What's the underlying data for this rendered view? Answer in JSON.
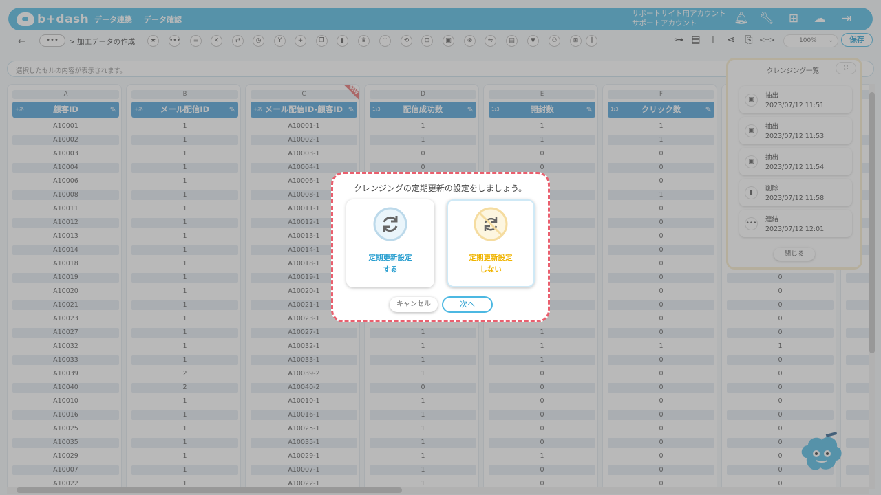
{
  "header": {
    "logo_text": "b+dash",
    "nav": [
      "データ連携",
      "データ確認"
    ],
    "account_lines": [
      "サポートサイト用アカウント",
      "サポートアカウント"
    ],
    "colors": {
      "brand": "#4cb8e2",
      "column_head": "#4a9fd8",
      "alert": "#ea5f6e"
    }
  },
  "toolbar": {
    "back_icon": "←",
    "more_icon": "•••",
    "breadcrumb": "> 加工データの作成",
    "zoom": "100%",
    "save_label": "保存"
  },
  "cell_bar": {
    "placeholder": "選択したセルの内容が表示されます。"
  },
  "grid": {
    "columns": [
      {
        "letter": "A",
        "name": "顧客ID",
        "type_icon": "+あ"
      },
      {
        "letter": "B",
        "name": "メール配信ID",
        "type_icon": "+あ"
      },
      {
        "letter": "C",
        "name": "メール配信ID-顧客ID",
        "type_icon": "+あ",
        "badge": "NEW"
      },
      {
        "letter": "D",
        "name": "配信成功数",
        "type_icon": "1₂3"
      },
      {
        "letter": "E",
        "name": "開封数",
        "type_icon": "1₂3"
      },
      {
        "letter": "F",
        "name": "クリック数",
        "type_icon": "1₂3"
      },
      {
        "letter": "",
        "name": "",
        "type_icon": ""
      },
      {
        "letter": "",
        "name": "",
        "type_icon": ""
      }
    ],
    "rows": [
      [
        "A10001",
        "1",
        "A10001-1",
        "1",
        "1",
        "1",
        "",
        ""
      ],
      [
        "A10002",
        "1",
        "A10002-1",
        "1",
        "1",
        "1",
        "",
        ""
      ],
      [
        "A10003",
        "1",
        "A10003-1",
        "0",
        "0",
        "0",
        "",
        ""
      ],
      [
        "A10004",
        "1",
        "A10004-1",
        "0",
        "0",
        "0",
        "",
        ""
      ],
      [
        "A10006",
        "1",
        "A10006-1",
        "",
        "",
        "0",
        "",
        ""
      ],
      [
        "A10008",
        "1",
        "A10008-1",
        "",
        "",
        "1",
        "",
        ""
      ],
      [
        "A10011",
        "1",
        "A10011-1",
        "",
        "",
        "0",
        "",
        ""
      ],
      [
        "A10012",
        "1",
        "A10012-1",
        "",
        "",
        "0",
        "",
        ""
      ],
      [
        "A10013",
        "1",
        "A10013-1",
        "",
        "",
        "0",
        "",
        ""
      ],
      [
        "A10014",
        "1",
        "A10014-1",
        "",
        "",
        "0",
        "",
        ""
      ],
      [
        "A10018",
        "1",
        "A10018-1",
        "",
        "",
        "0",
        "",
        ""
      ],
      [
        "A10019",
        "1",
        "A10019-1",
        "",
        "",
        "0",
        "0",
        ""
      ],
      [
        "A10020",
        "1",
        "A10020-1",
        "",
        "",
        "0",
        "0",
        ""
      ],
      [
        "A10021",
        "1",
        "A10021-1",
        "",
        "",
        "0",
        "0",
        ""
      ],
      [
        "A10023",
        "1",
        "A10023-1",
        "",
        "",
        "0",
        "0",
        ""
      ],
      [
        "A10027",
        "1",
        "A10027-1",
        "1",
        "1",
        "0",
        "0",
        ""
      ],
      [
        "A10032",
        "1",
        "A10032-1",
        "1",
        "1",
        "1",
        "1",
        ""
      ],
      [
        "A10033",
        "1",
        "A10033-1",
        "1",
        "1",
        "0",
        "0",
        ""
      ],
      [
        "A10039",
        "2",
        "A10039-2",
        "1",
        "0",
        "0",
        "0",
        ""
      ],
      [
        "A10040",
        "2",
        "A10040-2",
        "0",
        "0",
        "0",
        "0",
        ""
      ],
      [
        "A10010",
        "1",
        "A10010-1",
        "1",
        "0",
        "0",
        "0",
        ""
      ],
      [
        "A10016",
        "1",
        "A10016-1",
        "1",
        "0",
        "0",
        "0",
        ""
      ],
      [
        "A10025",
        "1",
        "A10025-1",
        "1",
        "0",
        "0",
        "0",
        ""
      ],
      [
        "A10035",
        "1",
        "A10035-1",
        "1",
        "0",
        "0",
        "0",
        ""
      ],
      [
        "A10029",
        "1",
        "A10029-1",
        "1",
        "1",
        "0",
        "0",
        ""
      ],
      [
        "A10007",
        "1",
        "A10007-1",
        "1",
        "0",
        "0",
        "0",
        ""
      ],
      [
        "A10022",
        "1",
        "A10022-1",
        "1",
        "0",
        "0",
        "0",
        ""
      ]
    ]
  },
  "history": {
    "title": "クレンジング一覧",
    "items": [
      {
        "icon": "extract-icon",
        "label": "抽出",
        "time": "2023/07/12 11:51"
      },
      {
        "icon": "extract-icon",
        "label": "抽出",
        "time": "2023/07/12 11:53"
      },
      {
        "icon": "extract-icon",
        "label": "抽出",
        "time": "2023/07/12 11:54"
      },
      {
        "icon": "delete-icon",
        "label": "削除",
        "time": "2023/07/12 11:58"
      },
      {
        "icon": "concat-icon",
        "label": "連結",
        "time": "2023/07/12 12:01"
      }
    ],
    "close_label": "閉じる"
  },
  "dialog": {
    "title": "クレンジングの定期更新の設定をしましょう。",
    "option_yes": {
      "line1": "定期更新設定",
      "line2": "する",
      "color": "#2a9fd0"
    },
    "option_no": {
      "line1": "定期更新設定",
      "line2": "しない",
      "color": "#f0b400"
    },
    "cancel_label": "キャンセル",
    "next_label": "次へ"
  }
}
